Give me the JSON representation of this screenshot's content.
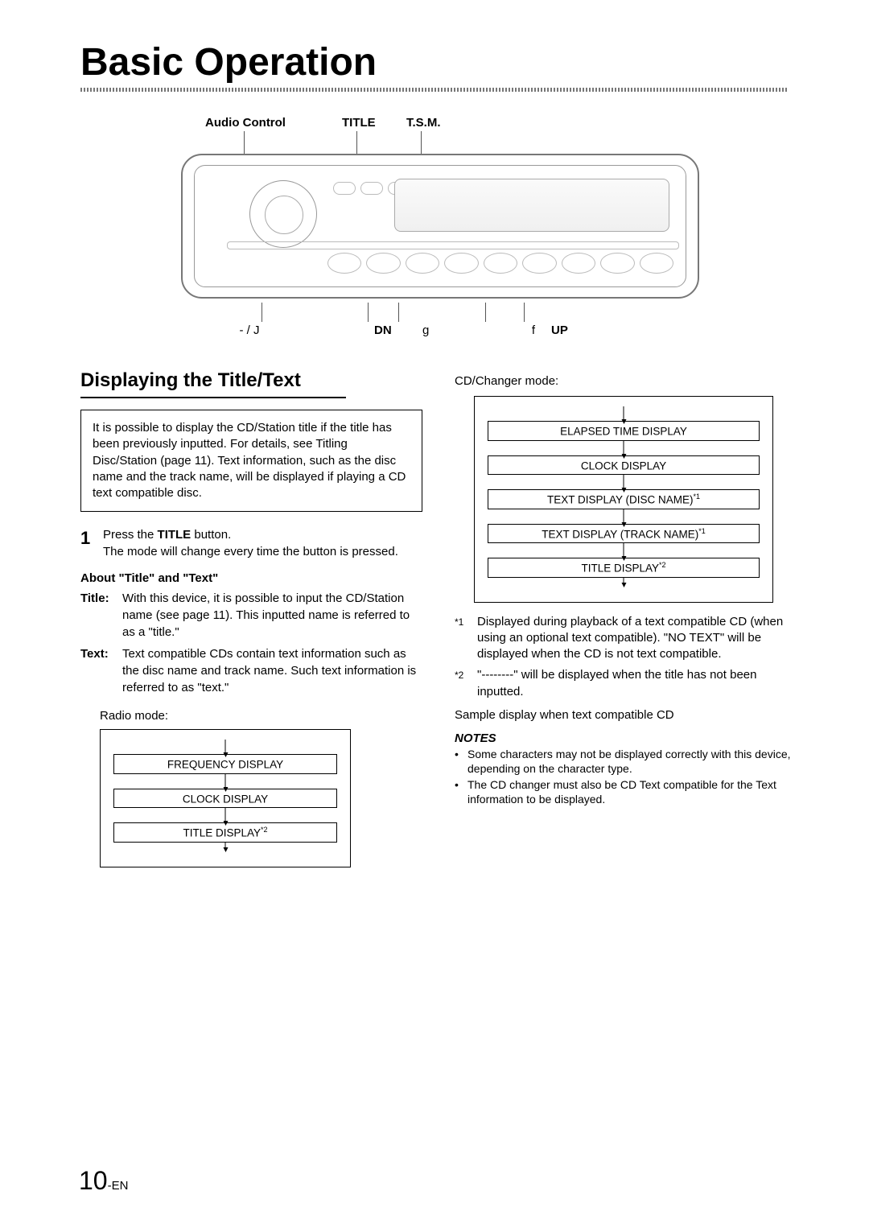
{
  "header": {
    "title": "Basic Operation"
  },
  "diagram": {
    "top_labels": {
      "audio": "Audio Control",
      "title": "TITLE",
      "tsm": "T.S.M."
    },
    "bottom_labels": {
      "play_pause": "-   / J",
      "dn": "DN",
      "g": "g",
      "f": "f",
      "up": "UP"
    }
  },
  "section": {
    "heading": "Displaying the Title/Text",
    "intro": "It is possible to display the CD/Station title if the title has been previously inputted. For details, see Titling Disc/Station (page 11). Text information, such as the disc name and the track name, will be displayed if playing a CD text compatible disc.",
    "step1_num": "1",
    "step1_a": "Press the ",
    "step1_button": "TITLE",
    "step1_b": " button.",
    "step1_c": "The mode will change every time the button is pressed.",
    "about_head": "About \"Title\" and \"Text\"",
    "title_label": "Title:",
    "title_def": "With this device, it is possible to input the CD/Station name (see page 11). This inputted name is referred to as a \"title.\"",
    "text_label": "Text:",
    "text_def": "Text compatible CDs contain text information such as the disc name and track name. Such text information is referred to as \"text.\"",
    "radio_mode_label": "Radio mode:",
    "radio_cycle": [
      "FREQUENCY DISPLAY",
      "CLOCK DISPLAY",
      "TITLE DISPLAY"
    ],
    "radio_cycle_sup": [
      "",
      "",
      "*2"
    ],
    "cd_mode_label": "CD/Changer mode:",
    "cd_cycle": [
      "ELAPSED TIME DISPLAY",
      "CLOCK DISPLAY",
      "TEXT DISPLAY (DISC NAME)",
      "TEXT DISPLAY (TRACK NAME)",
      "TITLE DISPLAY"
    ],
    "cd_cycle_sup": [
      "",
      "",
      "*1",
      "*1",
      "*2"
    ],
    "fn1_mark": "*1",
    "fn1": "Displayed during playback of a text compatible CD (when using an optional text compatible). \"NO TEXT\" will be displayed when the CD is not text compatible.",
    "fn2_mark": "*2",
    "fn2": "\"--------\" will be displayed when the title has not been inputted.",
    "sample": "Sample display when text compatible CD",
    "notes_head": "NOTES",
    "note1": "Some characters may not be displayed correctly with this device, depending on the character type.",
    "note2": "The CD changer must also be CD Text compatible for the Text information to be displayed."
  },
  "footer": {
    "page_big": "10",
    "page_suffix": "-EN"
  }
}
